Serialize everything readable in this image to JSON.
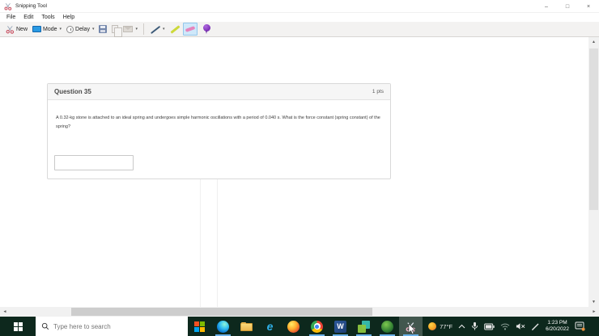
{
  "window": {
    "title": "Snipping Tool",
    "menu": [
      "File",
      "Edit",
      "Tools",
      "Help"
    ],
    "toolbar": {
      "new": "New",
      "mode": "Mode",
      "delay": "Delay"
    },
    "controls": {
      "minimize": "–",
      "maximize": "□",
      "close": "×"
    }
  },
  "icons": {
    "dropdown": "▾",
    "scroll_up": "▲",
    "scroll_down": "▼",
    "scroll_left": "◄",
    "scroll_right": "►",
    "ie_letter": "e",
    "word_letter": "W"
  },
  "snip": {
    "question_title": "Question 35",
    "points": "1 pts",
    "question_text": "A 0.32-kg stone is attached to an ideal spring and undergoes simple harmonic oscillations with a period of 0.040 s. What is the force constant (spring constant) of the spring?",
    "answer_value": ""
  },
  "taskbar": {
    "search_placeholder": "Type here to search",
    "weather_temp": "77°F",
    "clock_time": "1:23 PM",
    "clock_date": "6/20/2022"
  },
  "colors": {
    "taskbar_bg": "#0d281d",
    "running_underline": "#6ab1e8",
    "selected_tool_bg": "#cfe8fa",
    "card_header_bg": "#f6f6f6",
    "card_border": "#d9d9d9",
    "toolbar_bg": "#f3f2f1"
  }
}
